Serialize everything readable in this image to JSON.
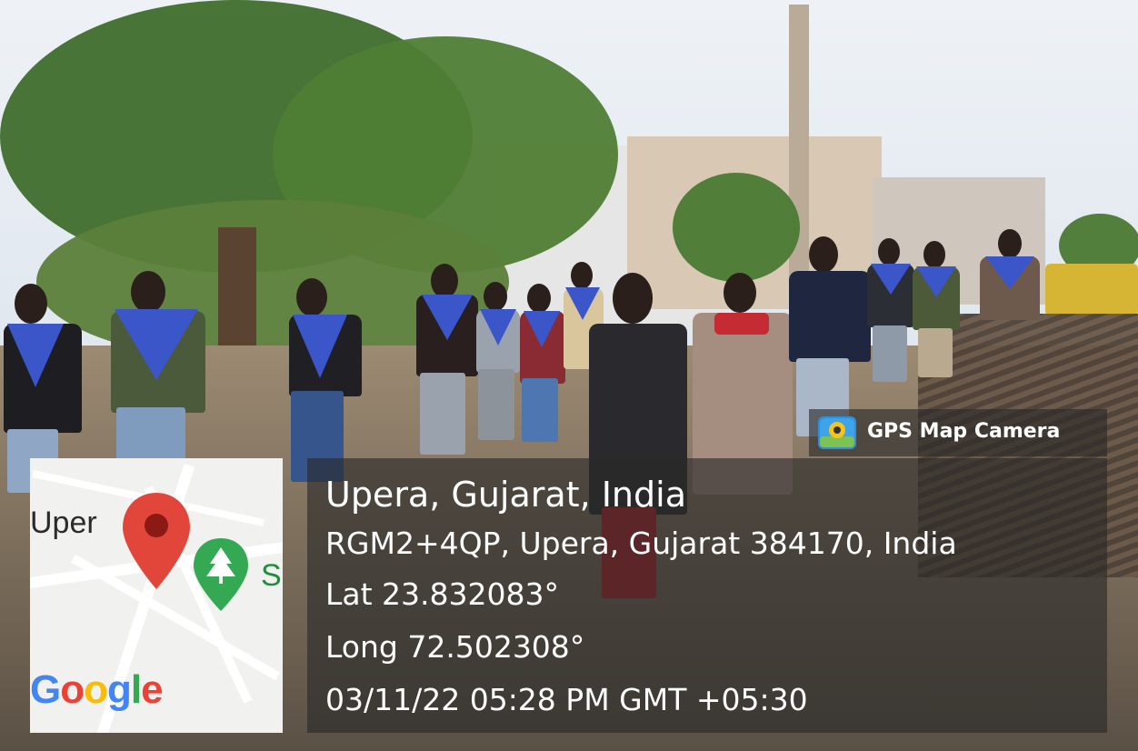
{
  "photo": {
    "description_alt": "Group of students with blue scarves walking on a village road"
  },
  "gps_badge": {
    "label": "GPS Map Camera",
    "icon": "map-camera-icon"
  },
  "location": {
    "place": "Upera, Gujarat, India",
    "address": "RGM2+4QP, Upera, Gujarat 384170, India",
    "latitude": "Lat 23.832083°",
    "longitude": "Long 72.502308°",
    "datetime": "03/11/22 05:28 PM GMT +05:30"
  },
  "map": {
    "place_label": "Uper",
    "side_label": "S",
    "brand": "Google",
    "pin_icon": "location-pin-icon",
    "park_icon": "park-tree-icon",
    "colors": {
      "pin": "#e2463a",
      "park": "#34a853",
      "g_blue": "#4285f4",
      "g_red": "#ea4335",
      "g_yellow": "#fbbc05",
      "g_green": "#34a853"
    }
  }
}
